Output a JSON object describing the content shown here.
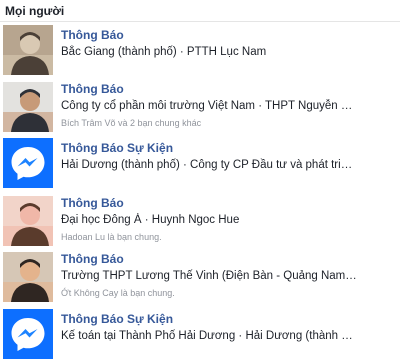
{
  "section": {
    "title": "Mọi người"
  },
  "results": [
    {
      "name": "Thông Báo",
      "detail": "Bắc Giang (thành phố) · PTTH Lục Nam",
      "mutual": "",
      "avatar": "person-photo-icon",
      "avatar_colors": [
        "#b7a58f",
        "#4b4037",
        "#d9c9b3"
      ]
    },
    {
      "name": "Thông Báo",
      "detail": "Công ty cổ phần môi trường Việt Nam · THPT Nguyễn …",
      "mutual": "Bích Trâm Võ và 2 bạn chung khác",
      "avatar": "person-photo-icon",
      "avatar_colors": [
        "#e3e2df",
        "#2e3037",
        "#c79a78"
      ]
    },
    {
      "name": "Thông Báo Sự Kiện",
      "detail": "Hải Dương (thành phố) · Công ty CP Đầu tư và phát tri…",
      "mutual": "",
      "avatar": "messenger-logo-icon",
      "avatar_colors": [
        "#0d6fff",
        "#ffffff",
        "#1d83ff"
      ]
    },
    {
      "name": "Thông Báo",
      "detail": "Đại học Đông Á · Huynh Ngoc Hue",
      "mutual": "Hadoan Lu là bạn chung.",
      "avatar": "person-photo-icon",
      "avatar_colors": [
        "#f2d4c9",
        "#5a3b2c",
        "#f0b7a8"
      ]
    },
    {
      "name": "Thông Báo",
      "detail": "Trường THPT Lương Thế Vinh (Điện Bàn - Quảng Nam…",
      "mutual": "Ớt Không Cay là bạn chung.",
      "avatar": "person-photo-icon",
      "avatar_colors": [
        "#d6c7b6",
        "#2f2622",
        "#e4b38c"
      ]
    },
    {
      "name": "Thông Báo Sự Kiện",
      "detail": "Kế toán tại Thành Phố Hải Dương · Hải Dương (thành …",
      "mutual": "",
      "avatar": "messenger-logo-icon",
      "avatar_colors": [
        "#0d6fff",
        "#ffffff",
        "#1d83ff"
      ]
    }
  ]
}
